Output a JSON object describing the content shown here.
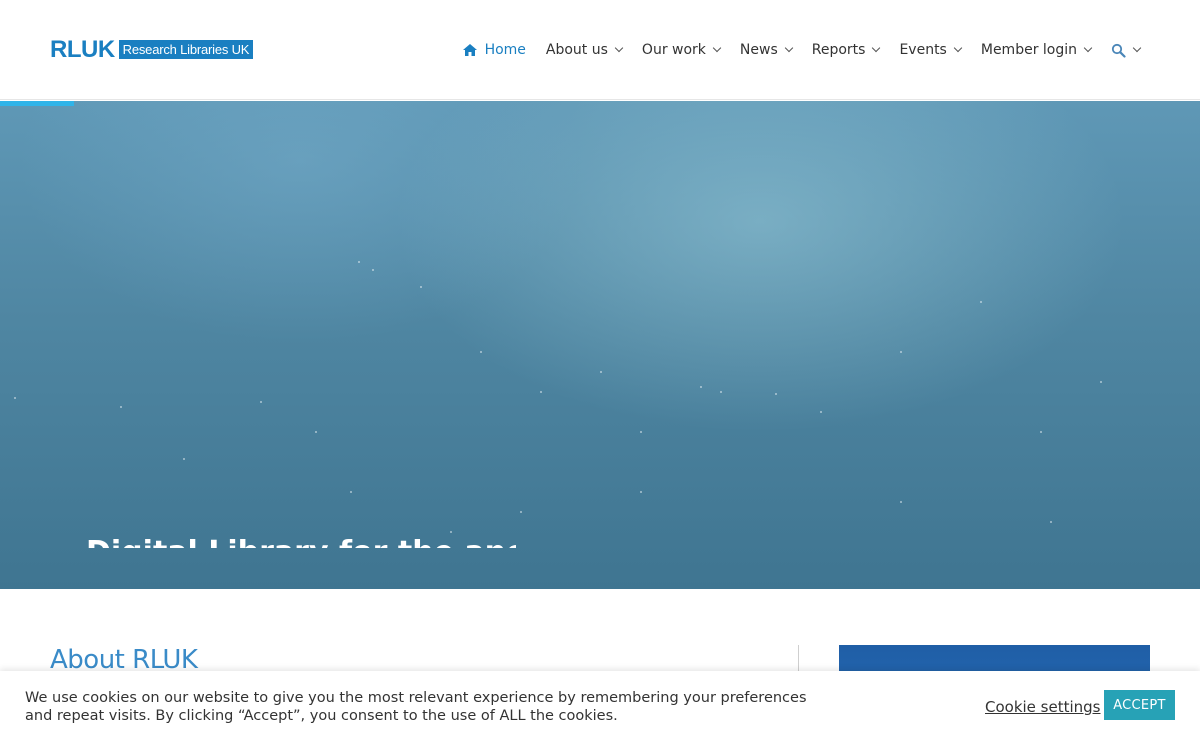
{
  "logo": {
    "short": "RLUK",
    "full": "Research Libraries UK"
  },
  "nav": {
    "items": [
      {
        "label": "Home",
        "icon": "home-icon",
        "active": true
      },
      {
        "label": "About us",
        "has_dropdown": true
      },
      {
        "label": "Our work",
        "has_dropdown": true
      },
      {
        "label": "News",
        "has_dropdown": true
      },
      {
        "label": "Reports",
        "has_dropdown": true
      },
      {
        "label": "Events",
        "has_dropdown": true
      },
      {
        "label": "Member login",
        "has_dropdown": true
      }
    ],
    "search_icon": "search-icon"
  },
  "hero": {
    "slide_count": 5,
    "caption": "Digital Library for the ancient"
  },
  "about": {
    "title": "About RLUK"
  },
  "cookie": {
    "text": "We use cookies on our website to give you the most relevant experience by remembering your preferences and repeat visits. By clicking “Accept”, you consent to the use of ALL the cookies.",
    "settings_label": "Cookie settings",
    "accept_label": "ACCEPT"
  },
  "colors": {
    "brand": "#1a7fc1",
    "accent_progress": "#2fb4e9",
    "accept_button": "#27a2b6",
    "hero_base": "#4f86a2"
  }
}
